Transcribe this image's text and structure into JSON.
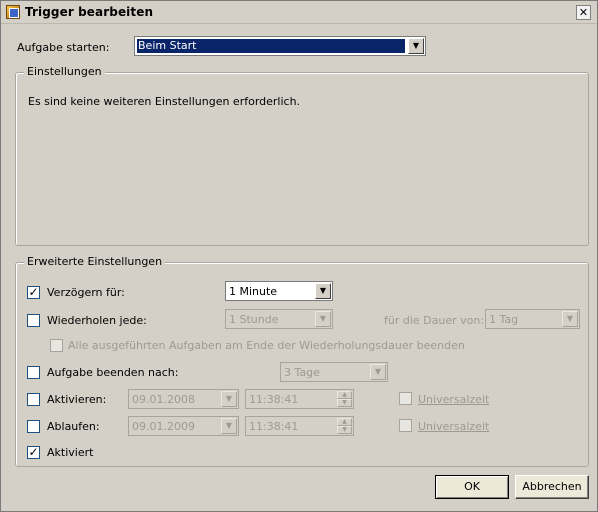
{
  "window": {
    "title": "Trigger bearbeiten",
    "close_glyph": "✕"
  },
  "start_task": {
    "label": "Aufgabe starten:",
    "value": "Beim Start"
  },
  "settings_group": {
    "title": "Einstellungen",
    "message": "Es sind keine weiteren Einstellungen erforderlich."
  },
  "advanced_group": {
    "title": "Erweiterte Einstellungen",
    "delay": {
      "checked": true,
      "label": "Verzögern für:",
      "value": "1 Minute"
    },
    "repeat": {
      "checked": false,
      "label": "Wiederholen jede:",
      "value": "1 Stunde",
      "duration_label": "für die Dauer von:",
      "duration_value": "1 Tag"
    },
    "stop_all": {
      "checked": false,
      "label": "Alle ausgeführten Aufgaben am Ende der Wiederholungsdauer beenden"
    },
    "stop_after": {
      "checked": false,
      "label": "Aufgabe beenden nach:",
      "value": "3 Tage"
    },
    "activate": {
      "checked": false,
      "label": "Aktivieren:",
      "date": "09.01.2008",
      "time": "11:38:41",
      "utc_label": "Universalzeit",
      "utc_checked": false
    },
    "expire": {
      "checked": false,
      "label": "Ablaufen:",
      "date": "09.01.2009",
      "time": "11:38:41",
      "utc_label": "Universalzeit",
      "utc_checked": false
    },
    "enabled": {
      "checked": true,
      "label": "Aktiviert"
    }
  },
  "buttons": {
    "ok": "OK",
    "cancel": "Abbrechen"
  },
  "glyphs": {
    "check": "✓",
    "down": "▼",
    "up": "▲"
  },
  "colors": {
    "face": "#d4d0c8",
    "selection": "#0a246a"
  }
}
